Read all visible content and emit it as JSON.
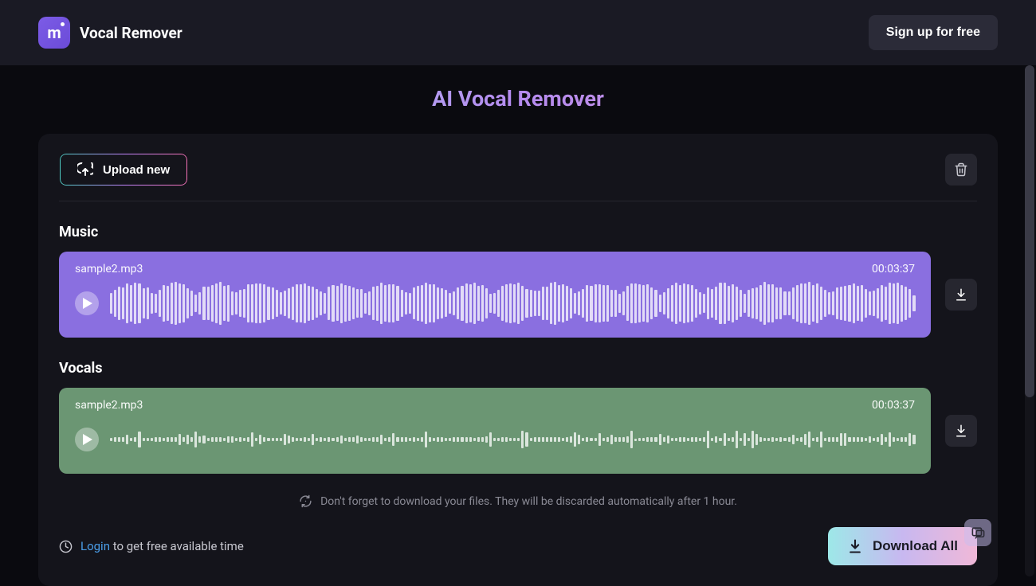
{
  "header": {
    "brand": "Vocal Remover",
    "logo_letter": "m",
    "signup_label": "Sign up for free"
  },
  "page": {
    "title": "AI Vocal Remover"
  },
  "toolbar": {
    "upload_label": "Upload new"
  },
  "tracks": {
    "music": {
      "section": "Music",
      "filename": "sample2.mp3",
      "duration": "00:03:37"
    },
    "vocals": {
      "section": "Vocals",
      "filename": "sample2.mp3",
      "duration": "00:03:37"
    }
  },
  "reminder": "Don't forget to download your files. They will be discarded automatically after 1 hour.",
  "footer": {
    "login_link": "Login",
    "login_rest": " to get free available time",
    "download_all": "Download All"
  }
}
